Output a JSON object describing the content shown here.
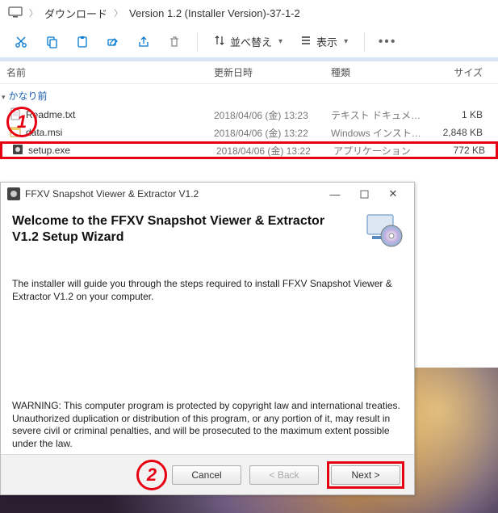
{
  "breadcrumb": {
    "monitor_alt": "This PC",
    "part1": "ダウンロード",
    "part2": "Version 1.2 (Installer Version)-37-1-2"
  },
  "toolbar": {
    "sort": "並べ替え",
    "view": "表示"
  },
  "columns": {
    "name": "名前",
    "date": "更新日時",
    "type": "種類",
    "size": "サイズ"
  },
  "group": "かなり前",
  "files": [
    {
      "name": "Readme.txt",
      "date": "2018/04/06 (金) 13:23",
      "type": "テキスト ドキュメント",
      "size": "1 KB",
      "icon": "text"
    },
    {
      "name": "data.msi",
      "date": "2018/04/06 (金) 13:22",
      "type": "Windows インストー...",
      "size": "2,848 KB",
      "icon": "msi"
    },
    {
      "name": "setup.exe",
      "date": "2018/04/06 (金) 13:22",
      "type": "アプリケーション",
      "size": "772 KB",
      "icon": "exe"
    }
  ],
  "annotation": {
    "one": "1",
    "two": "2"
  },
  "dialog": {
    "title": "FFXV Snapshot Viewer & Extractor V1.2",
    "welcome": "Welcome to the FFXV Snapshot Viewer & Extractor V1.2 Setup Wizard",
    "desc": "The installer will guide you through the steps required to install FFXV Snapshot Viewer & Extractor V1.2 on your computer.",
    "warn": "WARNING: This computer program is protected by copyright law and international treaties. Unauthorized duplication or distribution of this program, or any portion of it, may result in severe civil or criminal penalties, and will be prosecuted to the maximum extent possible under the law.",
    "cancel": "Cancel",
    "back": "< Back",
    "next": "Next >"
  }
}
